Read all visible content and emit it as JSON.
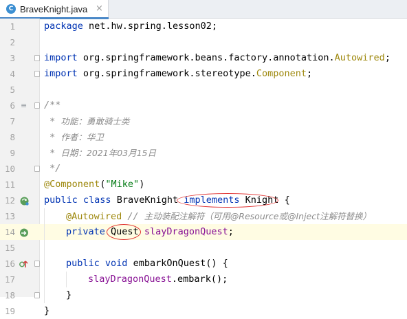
{
  "tab": {
    "title": "BraveKnight.java",
    "icon_letter": "C",
    "close": "×"
  },
  "lines": {
    "n": [
      "1",
      "2",
      "3",
      "4",
      "5",
      "6",
      "7",
      "8",
      "9",
      "10",
      "11",
      "12",
      "13",
      "14",
      "15",
      "16",
      "17",
      "18",
      "19"
    ],
    "l1": {
      "kw": "package",
      "rest": " net.hw.spring.lesson02;"
    },
    "l3": {
      "kw": "import",
      "pkg": " org.springframework.beans.factory.annotation.",
      "cls": "Autowired",
      "end": ";"
    },
    "l4": {
      "kw": "import",
      "pkg": " org.springframework.stereotype.",
      "cls": "Component",
      "end": ";"
    },
    "l6": "/**",
    "l7": {
      "star": " * ",
      "text": "功能：勇敢骑士类"
    },
    "l8": {
      "star": " * ",
      "text": "作者：华卫"
    },
    "l9": {
      "star": " * ",
      "text": "日期：2021年03月15日"
    },
    "l10": " */",
    "l11": {
      "ann": "@Component",
      "open": "(",
      "str": "\"Mike\"",
      "close": ")"
    },
    "l12": {
      "kw1": "public",
      "kw2": "class",
      "name": "BraveKnight",
      "kw3": "implements",
      "iface": "Knight",
      "brace": " {"
    },
    "l13": {
      "ann": "@Autowired",
      "cmt": " // ",
      "cmt_cn": "主动装配注解符（可用@Resource或@Inject注解符替换）"
    },
    "l14": {
      "kw": "private",
      "type": "Quest",
      "field": "slayDragonQuest",
      "end": ";"
    },
    "l16": {
      "kw1": "public",
      "kw2": "void",
      "name": "embarkOnQuest",
      "rest": "() {"
    },
    "l17": {
      "field": "slayDragonQuest",
      "rest": ".embark();"
    },
    "l18": "}",
    "l19": "}"
  },
  "colors": {
    "keyword": "#0033b3",
    "annotation": "#9e880d",
    "string": "#067d17",
    "field": "#871094",
    "comment": "#8c8c8c",
    "highlight_oval": "#e0302f"
  },
  "gutter_icons": {
    "line6": "doc-comment-icon",
    "line12": "implementing-class-icon",
    "line14": "autowired-bean-icon",
    "line16": "implements-method-icon"
  }
}
